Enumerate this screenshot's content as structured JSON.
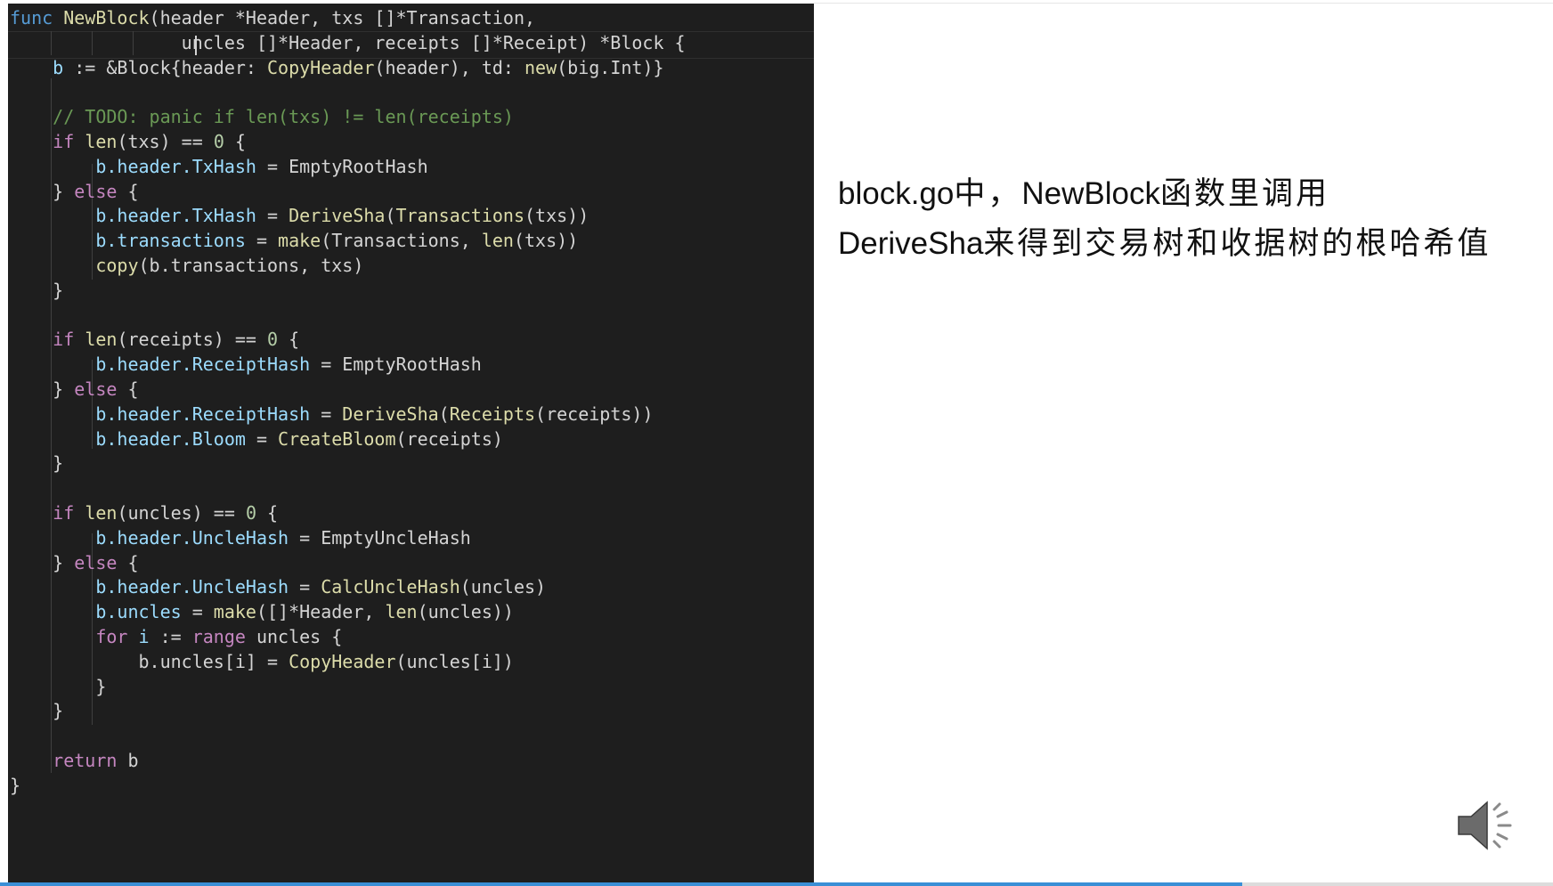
{
  "code": {
    "lines": [
      {
        "tokens": [
          [
            "kw",
            "func"
          ],
          [
            "plain",
            " "
          ],
          [
            "fn",
            "NewBlock"
          ],
          [
            "plain",
            "(header *Header, txs []*Transaction,"
          ]
        ]
      },
      {
        "tokens": [
          [
            "plain",
            "                "
          ],
          [
            "plain",
            "uncles []*Header, receipts []*Receipt) *Block {"
          ]
        ]
      },
      {
        "tokens": [
          [
            "plain",
            "    "
          ],
          [
            "var",
            "b"
          ],
          [
            "plain",
            " := &Block{header: "
          ],
          [
            "fn",
            "CopyHeader"
          ],
          [
            "plain",
            "(header), td: "
          ],
          [
            "fn",
            "new"
          ],
          [
            "plain",
            "(big.Int)}"
          ]
        ]
      },
      {
        "tokens": []
      },
      {
        "tokens": [
          [
            "plain",
            "    "
          ],
          [
            "cm",
            "// TODO: panic if len(txs) != len(receipts)"
          ]
        ]
      },
      {
        "tokens": [
          [
            "plain",
            "    "
          ],
          [
            "ctrl",
            "if"
          ],
          [
            "plain",
            " "
          ],
          [
            "fn",
            "len"
          ],
          [
            "plain",
            "(txs) == "
          ],
          [
            "num",
            "0"
          ],
          [
            "plain",
            " {"
          ]
        ]
      },
      {
        "tokens": [
          [
            "plain",
            "        "
          ],
          [
            "var",
            "b.header.TxHash"
          ],
          [
            "plain",
            " = EmptyRootHash"
          ]
        ]
      },
      {
        "tokens": [
          [
            "plain",
            "    } "
          ],
          [
            "ctrl",
            "else"
          ],
          [
            "plain",
            " {"
          ]
        ]
      },
      {
        "tokens": [
          [
            "plain",
            "        "
          ],
          [
            "var",
            "b.header.TxHash"
          ],
          [
            "plain",
            " = "
          ],
          [
            "fn",
            "DeriveSha"
          ],
          [
            "plain",
            "("
          ],
          [
            "fn",
            "Transactions"
          ],
          [
            "plain",
            "(txs))"
          ]
        ]
      },
      {
        "tokens": [
          [
            "plain",
            "        "
          ],
          [
            "var",
            "b.transactions"
          ],
          [
            "plain",
            " = "
          ],
          [
            "fn",
            "make"
          ],
          [
            "plain",
            "(Transactions, "
          ],
          [
            "fn",
            "len"
          ],
          [
            "plain",
            "(txs))"
          ]
        ]
      },
      {
        "tokens": [
          [
            "plain",
            "        "
          ],
          [
            "fn",
            "copy"
          ],
          [
            "plain",
            "(b.transactions, txs)"
          ]
        ]
      },
      {
        "tokens": [
          [
            "plain",
            "    }"
          ]
        ]
      },
      {
        "tokens": []
      },
      {
        "tokens": [
          [
            "plain",
            "    "
          ],
          [
            "ctrl",
            "if"
          ],
          [
            "plain",
            " "
          ],
          [
            "fn",
            "len"
          ],
          [
            "plain",
            "(receipts) == "
          ],
          [
            "num",
            "0"
          ],
          [
            "plain",
            " {"
          ]
        ]
      },
      {
        "tokens": [
          [
            "plain",
            "        "
          ],
          [
            "var",
            "b.header.ReceiptHash"
          ],
          [
            "plain",
            " = EmptyRootHash"
          ]
        ]
      },
      {
        "tokens": [
          [
            "plain",
            "    } "
          ],
          [
            "ctrl",
            "else"
          ],
          [
            "plain",
            " {"
          ]
        ]
      },
      {
        "tokens": [
          [
            "plain",
            "        "
          ],
          [
            "var",
            "b.header.ReceiptHash"
          ],
          [
            "plain",
            " = "
          ],
          [
            "fn",
            "DeriveSha"
          ],
          [
            "plain",
            "("
          ],
          [
            "fn",
            "Receipts"
          ],
          [
            "plain",
            "(receipts))"
          ]
        ]
      },
      {
        "tokens": [
          [
            "plain",
            "        "
          ],
          [
            "var",
            "b.header.Bloom"
          ],
          [
            "plain",
            " = "
          ],
          [
            "fn",
            "CreateBloom"
          ],
          [
            "plain",
            "(receipts)"
          ]
        ]
      },
      {
        "tokens": [
          [
            "plain",
            "    }"
          ]
        ]
      },
      {
        "tokens": []
      },
      {
        "tokens": [
          [
            "plain",
            "    "
          ],
          [
            "ctrl",
            "if"
          ],
          [
            "plain",
            " "
          ],
          [
            "fn",
            "len"
          ],
          [
            "plain",
            "(uncles) == "
          ],
          [
            "num",
            "0"
          ],
          [
            "plain",
            " {"
          ]
        ]
      },
      {
        "tokens": [
          [
            "plain",
            "        "
          ],
          [
            "var",
            "b.header.UncleHash"
          ],
          [
            "plain",
            " = EmptyUncleHash"
          ]
        ]
      },
      {
        "tokens": [
          [
            "plain",
            "    } "
          ],
          [
            "ctrl",
            "else"
          ],
          [
            "plain",
            " {"
          ]
        ]
      },
      {
        "tokens": [
          [
            "plain",
            "        "
          ],
          [
            "var",
            "b.header.UncleHash"
          ],
          [
            "plain",
            " = "
          ],
          [
            "fn",
            "CalcUncleHash"
          ],
          [
            "plain",
            "(uncles)"
          ]
        ]
      },
      {
        "tokens": [
          [
            "plain",
            "        "
          ],
          [
            "var",
            "b.uncles"
          ],
          [
            "plain",
            " = "
          ],
          [
            "fn",
            "make"
          ],
          [
            "plain",
            "([]*Header, "
          ],
          [
            "fn",
            "len"
          ],
          [
            "plain",
            "(uncles))"
          ]
        ]
      },
      {
        "tokens": [
          [
            "plain",
            "        "
          ],
          [
            "ctrl",
            "for"
          ],
          [
            "plain",
            " "
          ],
          [
            "var",
            "i"
          ],
          [
            "plain",
            " := "
          ],
          [
            "ctrl",
            "range"
          ],
          [
            "plain",
            " uncles {"
          ]
        ]
      },
      {
        "tokens": [
          [
            "plain",
            "            b.uncles[i] = "
          ],
          [
            "fn",
            "CopyHeader"
          ],
          [
            "plain",
            "(uncles[i])"
          ]
        ]
      },
      {
        "tokens": [
          [
            "plain",
            "        }"
          ]
        ]
      },
      {
        "tokens": [
          [
            "plain",
            "    }"
          ]
        ]
      },
      {
        "tokens": []
      },
      {
        "tokens": [
          [
            "plain",
            "    "
          ],
          [
            "ctrl",
            "return"
          ],
          [
            "plain",
            " b"
          ]
        ]
      },
      {
        "tokens": [
          [
            "plain",
            "}"
          ]
        ]
      }
    ]
  },
  "description": {
    "line1": [
      [
        "latin",
        "block.go"
      ],
      [
        "cjk",
        "中，"
      ],
      [
        "latin",
        "NewBlock"
      ],
      [
        "cjk",
        "函数里调用"
      ]
    ],
    "line2": [
      [
        "latin",
        "DeriveSha"
      ],
      [
        "cjk",
        "来得到交易树和收据树的根哈希值"
      ]
    ]
  },
  "icons": {
    "speaker": "speaker-volume-icon"
  },
  "playback": {
    "progress": 0.8
  },
  "colors": {
    "editor_bg": "#1e1e1e",
    "keyword": "#569cd6",
    "control": "#c586c0",
    "function": "#dcdcaa",
    "variable": "#9cdcfe",
    "number": "#b5cea8",
    "comment": "#6a9955",
    "progress": "#3a8fd6"
  }
}
